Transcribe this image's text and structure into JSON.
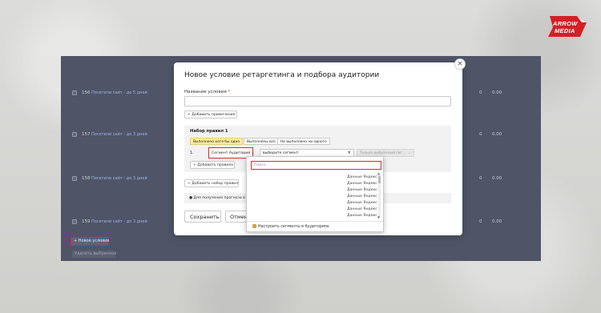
{
  "logo": {
    "line1": "ARROW",
    "line2": "MEDIA"
  },
  "background_list": {
    "rows": [
      {
        "id": "156",
        "name": "Посетили сайт - до 5 дней",
        "col_a": "0",
        "col_b": "0.00"
      },
      {
        "id": "157",
        "name": "Посетили сайт - до 3 дней",
        "col_a": "0",
        "col_b": "0.00"
      },
      {
        "id": "158",
        "name": "Посетили сайт - до 3 дней",
        "col_a": "0",
        "col_b": "0.00"
      },
      {
        "id": "159",
        "name": "Посетили сайт - до 3 дней",
        "col_a": "0",
        "col_b": "0.00"
      }
    ],
    "new_condition_button": "+ Новое условие",
    "delete_selected_button": "Удалить выбранное"
  },
  "modal": {
    "title": "Новое условие ретаргетинга и подбора аудитории",
    "close": "×",
    "name_label": "Название условия",
    "required_mark": "*",
    "name_value": "",
    "add_note": "+ Добавить примечание",
    "ruleset": {
      "title": "Набор правил 1",
      "modes": [
        {
          "label": "Выполнено хотя бы одно",
          "active": true
        },
        {
          "label": "Выполнены все",
          "active": false
        },
        {
          "label": "Не выполнено ни одного",
          "active": false
        }
      ],
      "rule_number": "1.",
      "rule_type": "Сегмент Аудиторий",
      "rule_type_arrow": "⌄",
      "segment_select": "выберите сегмент",
      "segment_arrow": "⬍",
      "only_selected": "Только выбранный сег...",
      "only_selected_arrow": "⌄",
      "add_rule": "+ Добавить правило"
    },
    "add_ruleset": "+ Добавить набор правил",
    "forecast": "Для получения прогноза в усл...",
    "save": "Сохранить",
    "cancel": "Отмена"
  },
  "dropdown": {
    "search_placeholder": "Поиск",
    "items": [
      "Данные Яндекс",
      "Данные Яндекс",
      "Данные Яндекс",
      "Данные Яндекс",
      "Данные Яндекс",
      "Данные Яндекс",
      "Данные Яндекс"
    ],
    "footer": "Настроить сегменты в Аудиториях"
  },
  "colors": {
    "accent_red": "#e0262b",
    "active_mode": "#ffeba0",
    "overlay": "#4f5567"
  }
}
